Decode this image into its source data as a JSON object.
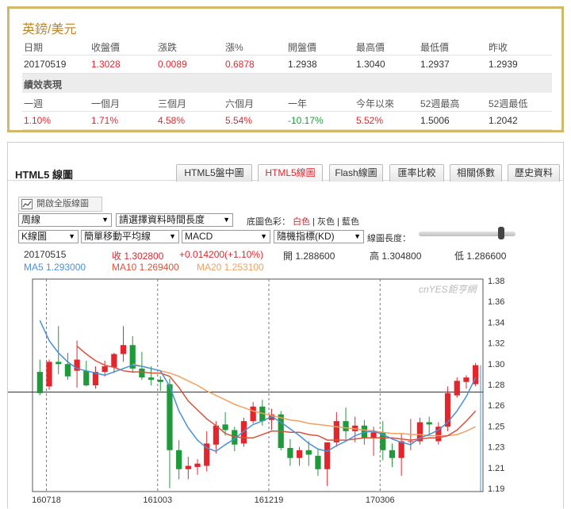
{
  "quote": {
    "title": "英鎊/美元",
    "headers": [
      "日期",
      "收盤價",
      "漲跌",
      "漲%",
      "開盤價",
      "最高價",
      "最低價",
      "昨收"
    ],
    "values": [
      "20170519",
      "1.3028",
      "0.0089",
      "0.6878",
      "1.2938",
      "1.3040",
      "1.2937",
      "1.2939"
    ],
    "perf_title": "績效表現",
    "perf_headers": [
      "一週",
      "一個月",
      "三個月",
      "六個月",
      "一年",
      "今年以來",
      "52週最高",
      "52週最低"
    ],
    "perf_values": [
      "1.10%",
      "1.71%",
      "4.58%",
      "5.54%",
      "-10.17%",
      "5.52%",
      "1.5006",
      "1.2042"
    ],
    "colors": {
      "up": "#e3262e",
      "down": "#1f9a3a",
      "gold_border": "#d4b86a"
    }
  },
  "panel": {
    "title": "HTML5 線圖",
    "tabs": [
      "HTML5盤中圖",
      "HTML5線圖",
      "Flash線圖",
      "匯率比較",
      "相關係數",
      "歷史資料"
    ],
    "active_tab": "HTML5線圖",
    "fullscreen_label": "開啟全版線圖",
    "period_select": "周線",
    "range_select": "請選擇資料時間長度",
    "bg_label": "底圖色彩：",
    "bg_white": "白色",
    "bg_gray": "灰色",
    "bg_blue": "藍色",
    "sep": "|",
    "chart_type_select": "K線圖",
    "ma_select": "簡單移動平均線",
    "indicator_select": "MACD",
    "indicator2_select": "隨機指標(KD)",
    "length_label": "線圖長度：",
    "slider_value": 0.85
  },
  "info": {
    "date": "20170515",
    "close": "收 1.302800",
    "change": "+0.014200(+1.10%)",
    "open": "開 1.288600",
    "high": "高 1.304800",
    "low": "低 1.286600",
    "ma5": "MA5 1.293000",
    "ma10": "MA10 1.269400",
    "ma20": "MA20 1.253100",
    "watermark": "cnYES鉅亨網"
  },
  "chart_data": {
    "type": "candlestick",
    "y_ticks": [
      "1.38",
      "1.36",
      "1.34",
      "1.32",
      "1.30",
      "1.28",
      "1.26",
      "1.25",
      "1.23",
      "1.21",
      "1.19"
    ],
    "x_ticks": [
      "160718",
      "161003",
      "161219",
      "170306"
    ],
    "ylim": [
      1.19,
      1.38
    ],
    "reference_line": 1.279,
    "colors": {
      "up": "#e3262e",
      "down": "#1f9a3a",
      "ma5": "#4a90d9",
      "ma10": "#d9533a",
      "ma20": "#f0a060"
    },
    "candles": [
      [
        1.297,
        1.308,
        1.276,
        1.278
      ],
      [
        1.284,
        1.308,
        1.281,
        1.306
      ],
      [
        1.306,
        1.338,
        1.295,
        1.304
      ],
      [
        1.304,
        1.314,
        1.29,
        1.293
      ],
      [
        1.298,
        1.325,
        1.283,
        1.308
      ],
      [
        1.298,
        1.307,
        1.284,
        1.285
      ],
      [
        1.285,
        1.302,
        1.282,
        1.297
      ],
      [
        1.297,
        1.307,
        1.293,
        1.302
      ],
      [
        1.301,
        1.314,
        1.296,
        1.313
      ],
      [
        1.313,
        1.338,
        1.306,
        1.321
      ],
      [
        1.321,
        1.329,
        1.296,
        1.3
      ],
      [
        1.3,
        1.315,
        1.29,
        1.292
      ],
      [
        1.292,
        1.302,
        1.285,
        1.29
      ],
      [
        1.29,
        1.293,
        1.28,
        1.288
      ],
      [
        1.286,
        1.291,
        1.193,
        1.227
      ],
      [
        1.227,
        1.236,
        1.201,
        1.21
      ],
      [
        1.21,
        1.221,
        1.201,
        1.213
      ],
      [
        1.212,
        1.219,
        1.205,
        1.215
      ],
      [
        1.213,
        1.244,
        1.208,
        1.233
      ],
      [
        1.232,
        1.253,
        1.224,
        1.249
      ],
      [
        1.25,
        1.261,
        1.24,
        1.245
      ],
      [
        1.245,
        1.248,
        1.226,
        1.232
      ],
      [
        1.233,
        1.256,
        1.23,
        1.253
      ],
      [
        1.253,
        1.27,
        1.251,
        1.266
      ],
      [
        1.266,
        1.272,
        1.249,
        1.253
      ],
      [
        1.254,
        1.264,
        1.245,
        1.259
      ],
      [
        1.259,
        1.262,
        1.227,
        1.229
      ],
      [
        1.229,
        1.237,
        1.213,
        1.22
      ],
      [
        1.22,
        1.23,
        1.213,
        1.227
      ],
      [
        1.227,
        1.235,
        1.213,
        1.223
      ],
      [
        1.222,
        1.228,
        1.204,
        1.21
      ],
      [
        1.21,
        1.226,
        1.195,
        1.234
      ],
      [
        1.234,
        1.261,
        1.23,
        1.253
      ],
      [
        1.253,
        1.265,
        1.237,
        1.244
      ],
      [
        1.244,
        1.257,
        1.234,
        1.249
      ],
      [
        1.249,
        1.254,
        1.232,
        1.238
      ],
      [
        1.238,
        1.248,
        1.222,
        1.243
      ],
      [
        1.243,
        1.253,
        1.218,
        1.227
      ],
      [
        1.227,
        1.233,
        1.212,
        1.22
      ],
      [
        1.22,
        1.242,
        1.204,
        1.235
      ],
      [
        1.235,
        1.255,
        1.227,
        1.235
      ],
      [
        1.235,
        1.256,
        1.232,
        1.252
      ],
      [
        1.252,
        1.257,
        1.24,
        1.25
      ],
      [
        1.235,
        1.252,
        1.232,
        1.248
      ],
      [
        1.248,
        1.284,
        1.244,
        1.278
      ],
      [
        1.276,
        1.292,
        1.274,
        1.289
      ],
      [
        1.288,
        1.294,
        1.282,
        1.292
      ],
      [
        1.286,
        1.305,
        1.284,
        1.303
      ]
    ],
    "ma5_line": [
      1.343,
      1.325,
      1.314,
      1.306,
      1.3,
      1.298,
      1.296,
      1.294,
      1.297,
      1.3,
      1.303,
      1.302,
      1.3,
      1.298,
      1.284,
      1.262,
      1.247,
      1.236,
      1.229,
      1.226,
      1.232,
      1.237,
      1.244,
      1.25,
      1.253,
      1.257,
      1.252,
      1.246,
      1.24,
      1.233,
      1.228,
      1.226,
      1.231,
      1.235,
      1.24,
      1.243,
      1.244,
      1.241,
      1.237,
      1.234,
      1.232,
      1.238,
      1.241,
      1.245,
      1.252,
      1.262,
      1.275,
      1.292
    ],
    "ma10_line": [
      null,
      null,
      null,
      null,
      1.32,
      1.313,
      1.307,
      1.303,
      1.301,
      1.298,
      1.297,
      1.297,
      1.296,
      1.296,
      1.293,
      1.283,
      1.271,
      1.263,
      1.255,
      1.249,
      1.242,
      1.239,
      1.238,
      1.238,
      1.241,
      1.244,
      1.244,
      1.243,
      1.243,
      1.241,
      1.24,
      1.236,
      1.236,
      1.236,
      1.237,
      1.238,
      1.238,
      1.238,
      1.238,
      1.237,
      1.236,
      1.237,
      1.238,
      1.238,
      1.24,
      1.245,
      1.253,
      1.262
    ],
    "ma20_line": [
      null,
      null,
      null,
      null,
      null,
      null,
      null,
      null,
      null,
      null,
      1.304,
      1.302,
      1.3,
      1.298,
      1.296,
      1.293,
      1.289,
      1.285,
      1.28,
      1.276,
      1.272,
      1.268,
      1.265,
      1.262,
      1.26,
      1.258,
      1.256,
      1.254,
      1.253,
      1.251,
      1.25,
      1.249,
      1.248,
      1.247,
      1.246,
      1.245,
      1.244,
      1.243,
      1.242,
      1.242,
      1.241,
      1.241,
      1.24,
      1.24,
      1.24,
      1.241,
      1.244,
      1.248
    ]
  }
}
